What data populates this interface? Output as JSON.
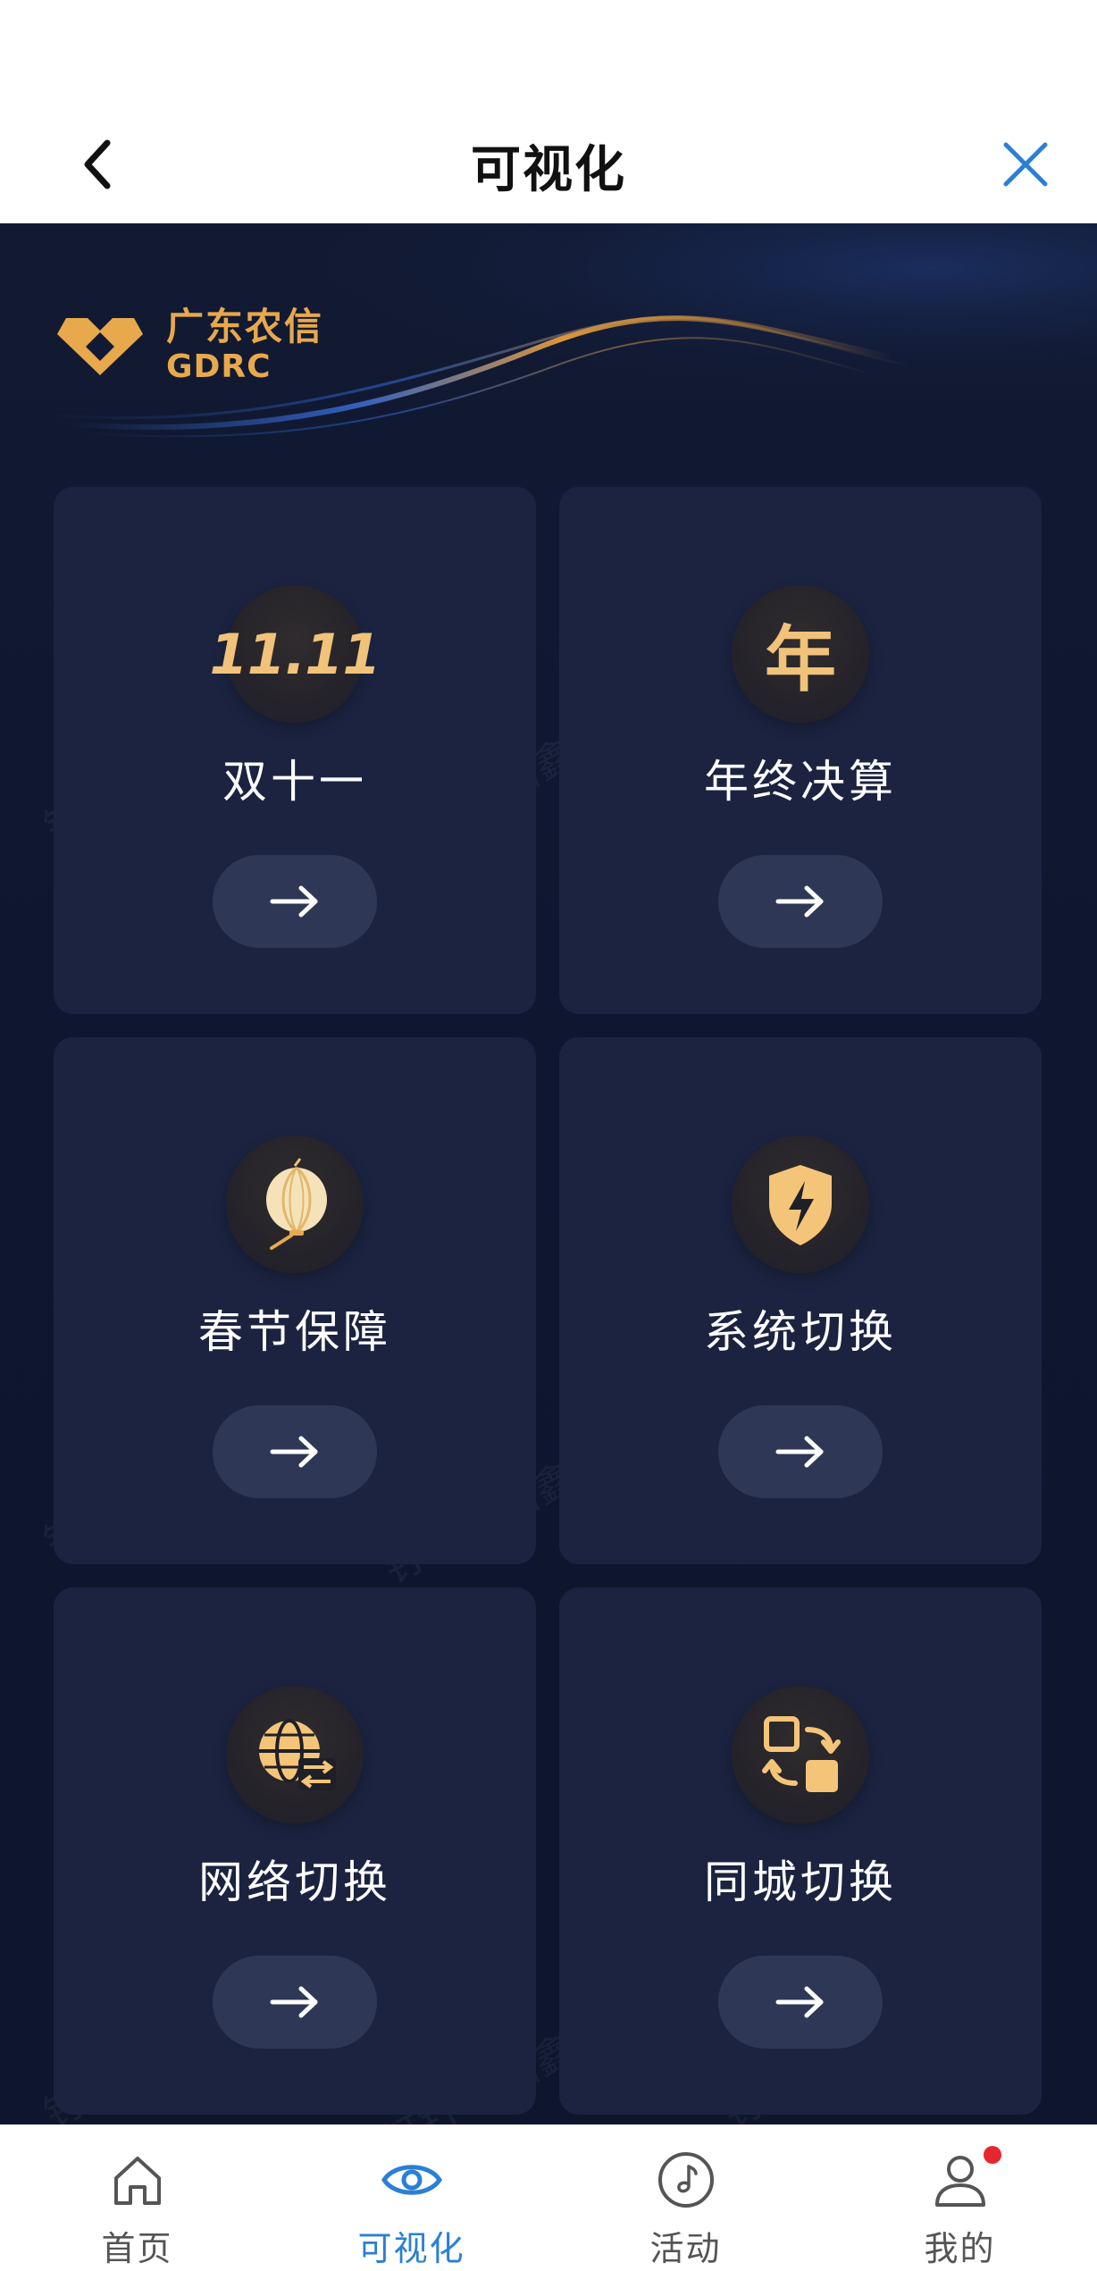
{
  "header": {
    "title": "可视化"
  },
  "brand": {
    "name_cn": "广东农信",
    "name_en": "GDRC"
  },
  "cards": [
    {
      "title": "双十一",
      "icon": "11-11-icon",
      "icon_text": "11.11"
    },
    {
      "title": "年终决算",
      "icon": "year-icon",
      "icon_text": "年"
    },
    {
      "title": "春节保障",
      "icon": "lantern-icon"
    },
    {
      "title": "系统切换",
      "icon": "lightning-shield-icon"
    },
    {
      "title": "网络切换",
      "icon": "globe-exchange-icon"
    },
    {
      "title": "同城切换",
      "icon": "swap-squares-icon"
    }
  ],
  "watermark": {
    "text": "钉钉 姚培鑫 2669"
  },
  "tabbar": {
    "items": [
      {
        "label": "首页",
        "icon": "home-icon"
      },
      {
        "label": "可视化",
        "icon": "eye-icon",
        "active": true
      },
      {
        "label": "活动",
        "icon": "music-note-circle-icon"
      },
      {
        "label": "我的",
        "icon": "user-icon",
        "badge": true
      }
    ]
  },
  "colors": {
    "accent": "#2b7fd4",
    "gold": "#f0c27a",
    "background": "#0d1426",
    "card": "#1b2340",
    "badge": "#e8262e"
  }
}
